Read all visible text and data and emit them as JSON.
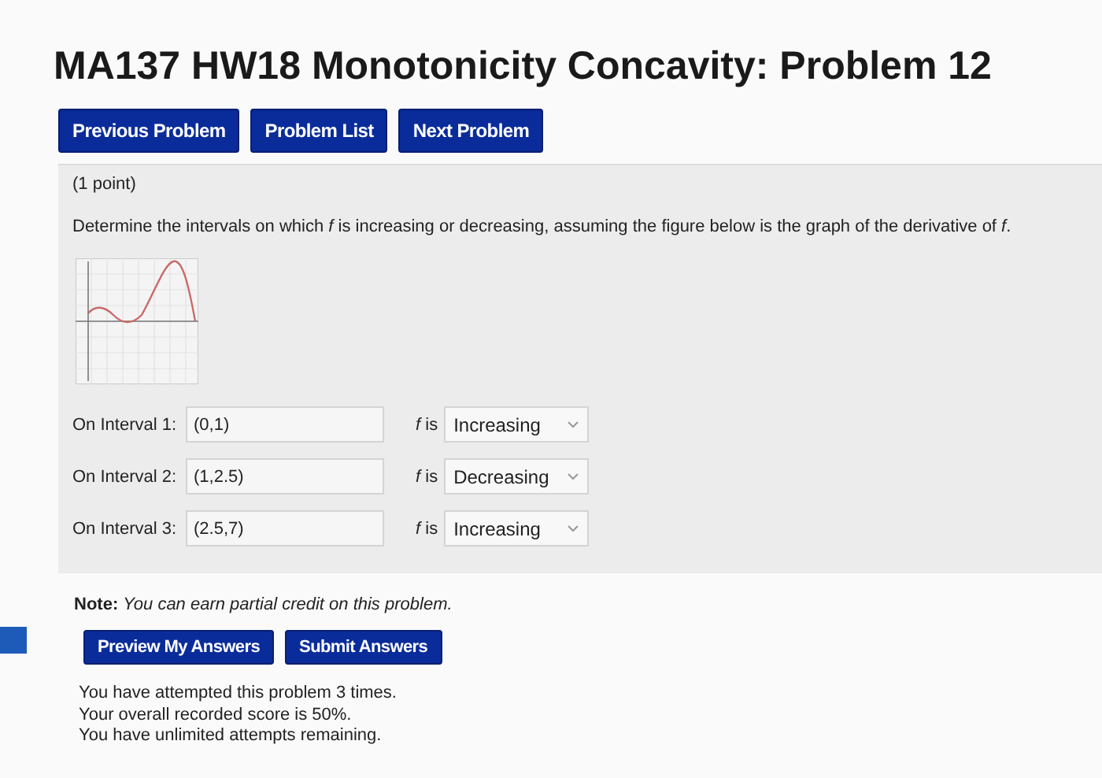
{
  "title": "MA137 HW18 Monotonicity Concavity: Problem 12",
  "nav_buttons": [
    "Previous Problem",
    "Problem List",
    "Next Problem"
  ],
  "problem": {
    "points": "(1 point)",
    "statement": "Determine the intervals on which *f* is increasing or decreasing, assuming the figure below is the graph of the derivative of *f*.",
    "rows": [
      {
        "label": "On Interval 1:",
        "value": "(0,1)",
        "prefix": "*f* is",
        "choice": "Increasing"
      },
      {
        "label": "On Interval 2:",
        "value": "(1,2.5)",
        "prefix": "*f* is",
        "choice": "Decreasing"
      },
      {
        "label": "On Interval 3:",
        "value": "(2.5,7)",
        "prefix": "*f* is",
        "choice": "Increasing"
      }
    ]
  },
  "note": "**Note:** *You can earn partial credit on this problem.*",
  "action_buttons": [
    "Preview My Answers",
    "Submit Answers"
  ],
  "status_lines": [
    "You have attempted this problem 3 times.",
    "Your overall recorded score is 50%.",
    "You have unlimited attempts remaining."
  ]
}
